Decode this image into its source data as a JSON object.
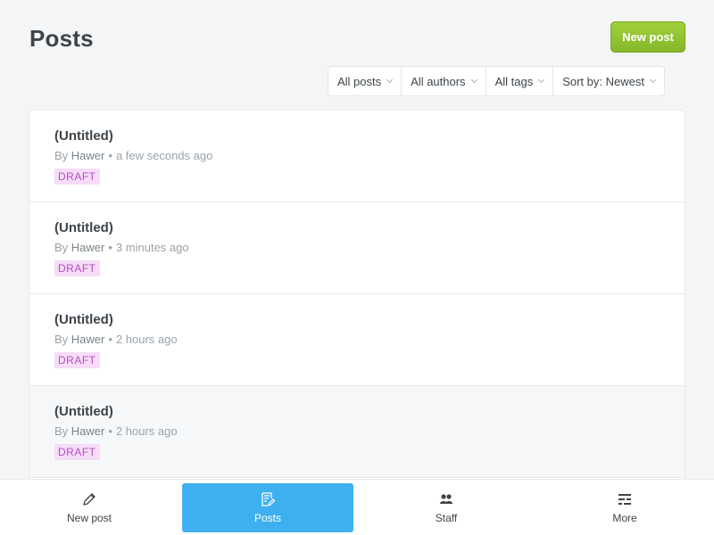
{
  "header": {
    "title": "Posts",
    "new_post_label": "New post"
  },
  "filters": [
    {
      "label": "All posts"
    },
    {
      "label": "All authors"
    },
    {
      "label": "All tags"
    },
    {
      "label": "Sort by: Newest"
    }
  ],
  "posts": [
    {
      "title": "(Untitled)",
      "by": "By",
      "author": "Hawer",
      "time": "a few seconds ago",
      "status": "DRAFT"
    },
    {
      "title": "(Untitled)",
      "by": "By",
      "author": "Hawer",
      "time": "3 minutes ago",
      "status": "DRAFT"
    },
    {
      "title": "(Untitled)",
      "by": "By",
      "author": "Hawer",
      "time": "2 hours ago",
      "status": "DRAFT"
    },
    {
      "title": "(Untitled)",
      "by": "By",
      "author": "Hawer",
      "time": "2 hours ago",
      "status": "DRAFT"
    }
  ],
  "tabbar": [
    {
      "label": "New post",
      "icon": "pencil-icon"
    },
    {
      "label": "Posts",
      "icon": "posts-icon"
    },
    {
      "label": "Staff",
      "icon": "staff-icon"
    },
    {
      "label": "More",
      "icon": "more-icon"
    }
  ],
  "colors": {
    "accent": "#3eb0ef",
    "primary_button": "#9fcf3a",
    "draft_badge_text": "#b24fc1",
    "draft_badge_bg": "#f6dcf7"
  }
}
